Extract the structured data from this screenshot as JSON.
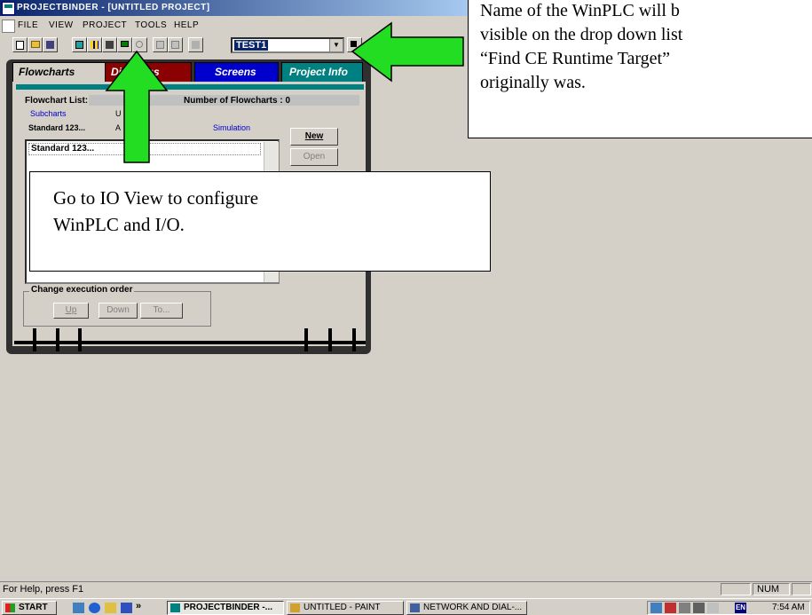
{
  "window": {
    "title": "ProjectBinder - [Untitled Project]"
  },
  "menu": {
    "items": [
      "File",
      "View",
      "Project",
      "Tools",
      "Help"
    ]
  },
  "toolbar": {
    "target_combo_value": "TEST1",
    "combo_arrow": "▼"
  },
  "binder": {
    "tabs": [
      "Flowcharts",
      "Diagrams",
      "Screens",
      "Project Info"
    ],
    "flowchart_list_label": "Flowchart List:",
    "count_label": "Number of Flowcharts : 0",
    "subtabs": {
      "row1": [
        "Subcharts",
        "U"
      ],
      "row2": [
        "Standard 123...",
        "A",
        "Simulation"
      ]
    },
    "list_items": [
      "Standard 123..."
    ],
    "buttons": {
      "new": "New",
      "open": "Open"
    },
    "exec_group": {
      "legend": "Change execution order",
      "up": "Up",
      "down": "Down",
      "to": "To..."
    }
  },
  "callouts": {
    "top_lines": [
      "Name of the WinPLC  will b",
      "visible on the drop down list",
      "“Find CE Runtime Target”",
      "originally was."
    ],
    "io_lines": [
      "Go to IO View to configure",
      "WinPLC and I/O."
    ]
  },
  "statusbar": {
    "help_text": "For Help, press F1",
    "num": "NUM"
  },
  "taskbar": {
    "start": "Start",
    "chevron": "»",
    "buttons": [
      "ProjectBinder -...",
      "untitled - Paint",
      "Network and Dial-..."
    ],
    "clock": "7:54 AM",
    "lang": "EN"
  },
  "colors": {
    "arrow_green": "#22dd22",
    "tab_diagrams": "#8b0000",
    "tab_screens": "#0000cc",
    "tab_project_info": "#008080",
    "title_gradient_start": "#0a246a"
  }
}
